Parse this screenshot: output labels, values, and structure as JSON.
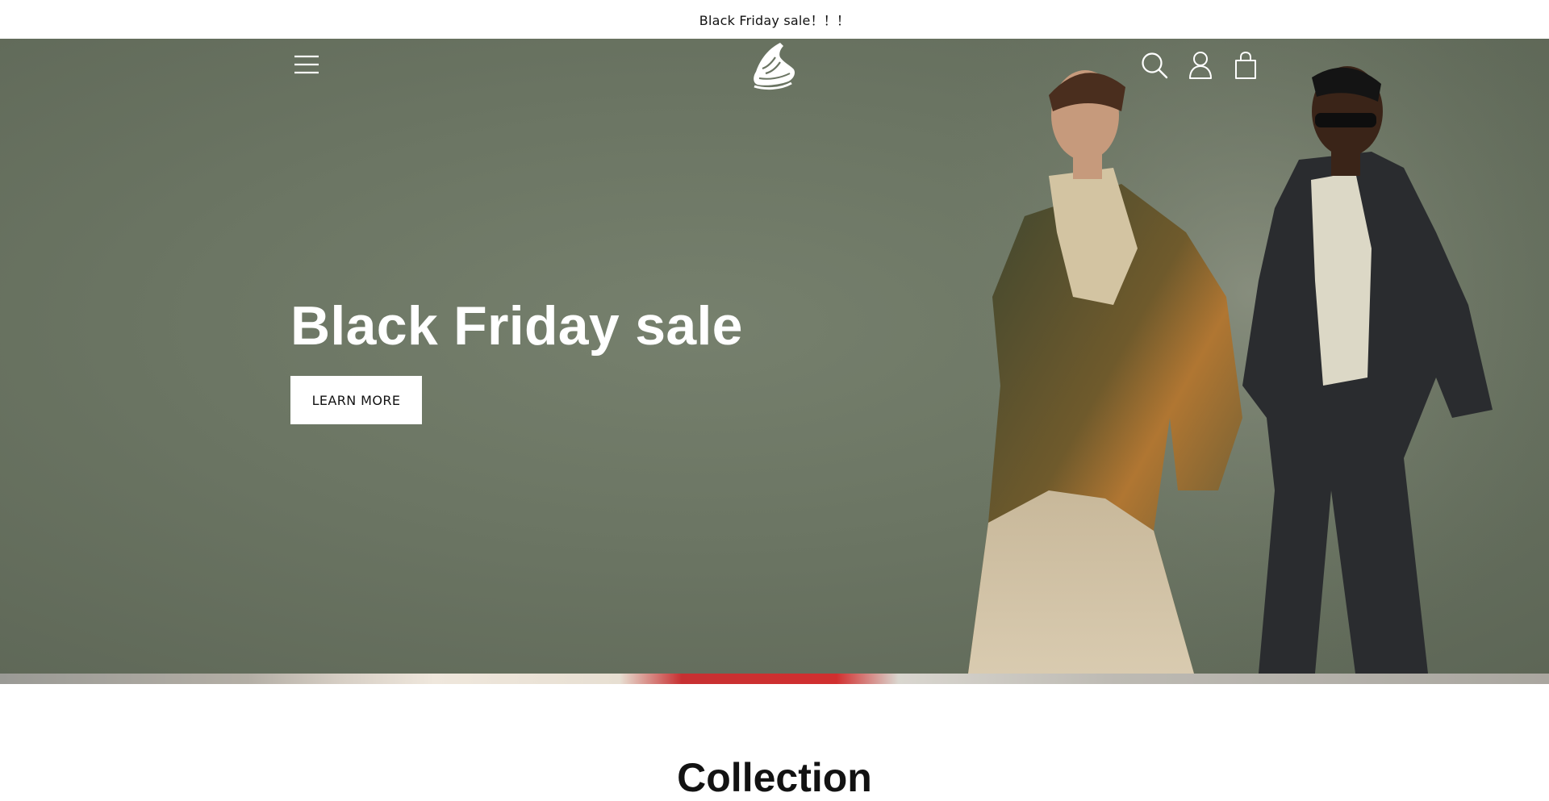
{
  "announcement": {
    "text": "Black Friday sale！！！"
  },
  "header": {
    "menu_icon": "hamburger-menu-icon",
    "logo_icon": "sneaker-logo-icon",
    "search_icon": "search-icon",
    "account_icon": "account-icon",
    "cart_icon": "shopping-bag-icon"
  },
  "hero": {
    "title": "Black Friday sale",
    "cta_label": "LEARN MORE",
    "slides_total": 2,
    "active_slide": 1
  },
  "collection": {
    "heading": "Collection"
  },
  "colors": {
    "hero_background": "#6b7563",
    "text_dark": "#121212",
    "white": "#ffffff"
  }
}
